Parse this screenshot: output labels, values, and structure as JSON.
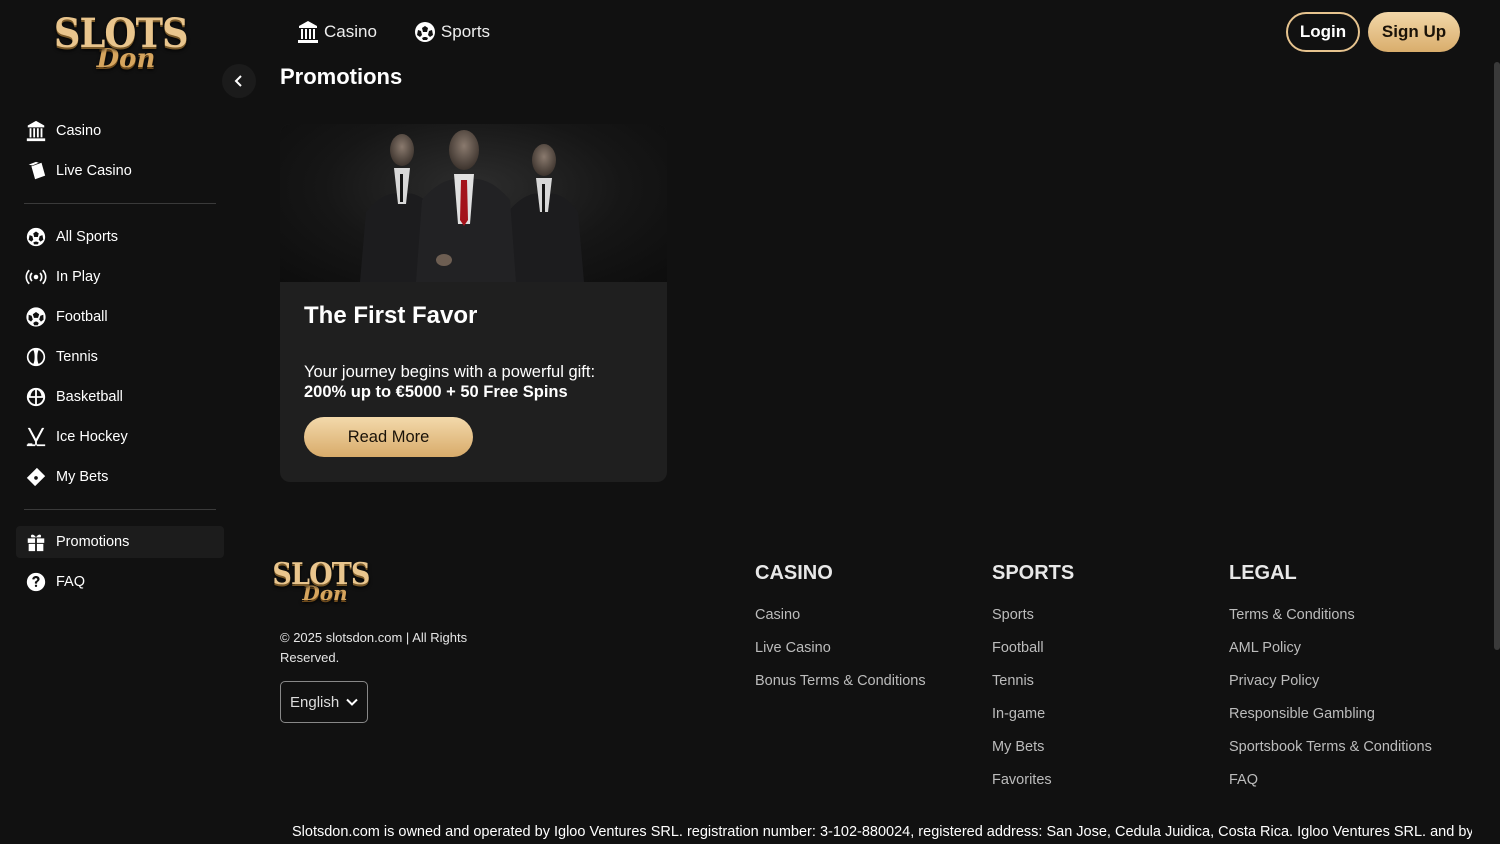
{
  "brand": {
    "line1": "SLOTS",
    "line2": "Don"
  },
  "topnav": [
    {
      "label": "Casino",
      "icon": "casino-building-icon"
    },
    {
      "label": "Sports",
      "icon": "soccer-ball-icon"
    }
  ],
  "auth": {
    "login": "Login",
    "signup": "Sign Up"
  },
  "sidebar": {
    "items": [
      {
        "label": "Casino",
        "icon": "casino-building-icon"
      },
      {
        "label": "Live Casino",
        "icon": "playing-cards-icon"
      },
      {
        "label": "All Sports",
        "icon": "soccer-ball-icon"
      },
      {
        "label": "In Play",
        "icon": "broadcast-icon"
      },
      {
        "label": "Football",
        "icon": "football-icon"
      },
      {
        "label": "Tennis",
        "icon": "tennis-ball-icon"
      },
      {
        "label": "Basketball",
        "icon": "basketball-icon"
      },
      {
        "label": "Ice Hockey",
        "icon": "hockey-icon"
      },
      {
        "label": "My Bets",
        "icon": "ticket-icon"
      },
      {
        "label": "Promotions",
        "icon": "gift-icon",
        "active": true
      },
      {
        "label": "FAQ",
        "icon": "question-icon"
      }
    ]
  },
  "page": {
    "title": "Promotions"
  },
  "promo": {
    "title": "The First Favor",
    "desc": "Your journey begins with a powerful gift:",
    "highlight": "200% up to €5000 + 50 Free Spins",
    "button": "Read More"
  },
  "footer": {
    "copyright": "© 2025 slotsdon.com | All Rights Reserved.",
    "language": "English",
    "casino": {
      "title": "CASINO",
      "links": [
        "Casino",
        "Live Casino",
        "Bonus Terms & Conditions"
      ]
    },
    "sports": {
      "title": "SPORTS",
      "links": [
        "Sports",
        "Football",
        "Tennis",
        "In-game",
        "My Bets",
        "Favorites"
      ]
    },
    "legal": {
      "title": "LEGAL",
      "links": [
        "Terms & Conditions",
        "AML Policy",
        "Privacy Policy",
        "Responsible Gambling",
        "Sportsbook Terms & Conditions",
        "FAQ"
      ]
    },
    "disclaimer": "Slotsdon.com is owned and operated by Igloo Ventures SRL. registration number: 3-102-880024, registered address: San Jose, Cedula Juidica, Costa Rica. Igloo Ventures SRL. and by"
  },
  "colors": {
    "accent": "#e6c38e",
    "background": "#111111",
    "card": "#1f1f1f"
  }
}
